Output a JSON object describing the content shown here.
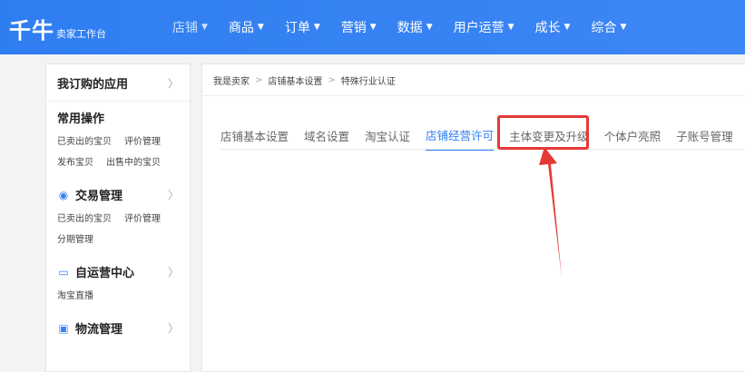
{
  "header": {
    "logo": "千牛",
    "logo_sub": "卖家工作台",
    "nav": [
      {
        "label": "店铺"
      },
      {
        "label": "商品"
      },
      {
        "label": "订单"
      },
      {
        "label": "营销"
      },
      {
        "label": "数据"
      },
      {
        "label": "用户运营"
      },
      {
        "label": "成长"
      },
      {
        "label": "综合"
      }
    ]
  },
  "sidebar": {
    "head": "我订购的应用",
    "common": {
      "title": "常用操作",
      "links": [
        "已卖出的宝贝",
        "评价管理",
        "发布宝贝",
        "出售中的宝贝"
      ]
    },
    "trade": {
      "title": "交易管理",
      "links": [
        "已卖出的宝贝",
        "评价管理",
        "分期管理"
      ]
    },
    "self_op": {
      "title": "自运营中心",
      "links": [
        "淘宝直播"
      ]
    },
    "logistics": {
      "title": "物流管理"
    }
  },
  "breadcrumb": [
    "我是卖家",
    "店铺基本设置",
    "特殊行业认证"
  ],
  "tabs": [
    {
      "label": "店铺基本设置"
    },
    {
      "label": "域名设置"
    },
    {
      "label": "淘宝认证"
    },
    {
      "label": "店铺经营许可"
    },
    {
      "label": "主体变更及升级"
    },
    {
      "label": "个体户亮照"
    },
    {
      "label": "子账号管理"
    }
  ],
  "colors": {
    "header_bg": "#2f7ef1",
    "active_tab": "#2f7ef1",
    "annotation_red": "#e53935"
  }
}
